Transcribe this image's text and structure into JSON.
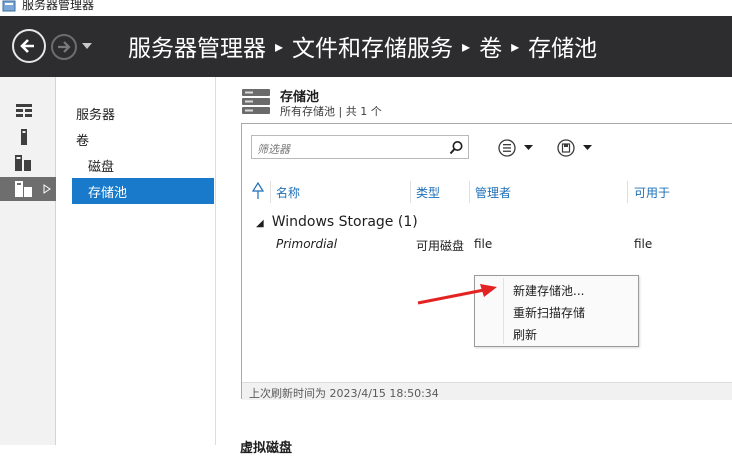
{
  "window": {
    "title": "服务器管理器"
  },
  "breadcrumb": [
    "服务器管理器",
    "文件和存储服务",
    "卷",
    "存储池"
  ],
  "navtree": {
    "items": [
      {
        "label": "服务器",
        "level": 0,
        "selected": false
      },
      {
        "label": "卷",
        "level": 0,
        "selected": false
      },
      {
        "label": "磁盘",
        "level": 1,
        "selected": false
      },
      {
        "label": "存储池",
        "level": 1,
        "selected": true
      }
    ]
  },
  "section": {
    "title": "存储池",
    "subtitle": "所有存储池 | 共 1 个"
  },
  "filter": {
    "placeholder": "筛选器"
  },
  "table": {
    "columns": [
      "名称",
      "类型",
      "管理者",
      "可用于"
    ],
    "group": "Windows Storage (1)",
    "rows": [
      {
        "name": "Primordial",
        "type": "可用磁盘",
        "managed_by": "file",
        "available_to": "file"
      }
    ]
  },
  "status": {
    "refresh": "上次刷新时间为 2023/4/15 18:50:34"
  },
  "context_menu": {
    "items": [
      "新建存储池...",
      "重新扫描存储",
      "刷新"
    ]
  },
  "next_section": {
    "title": "虚拟磁盘"
  },
  "colors": {
    "nav_bg": "#2d2d30",
    "selected": "#1979ca",
    "header_text": "#1d6fb8",
    "arrow": "#e32222"
  },
  "icons": [
    "back-arrow-icon",
    "forward-arrow-icon",
    "dashboard-icon",
    "server-icon",
    "servers-icon",
    "storage-icon",
    "storage-pool-icon",
    "search-icon",
    "list-options-icon",
    "task-icon",
    "sort-icon"
  ]
}
